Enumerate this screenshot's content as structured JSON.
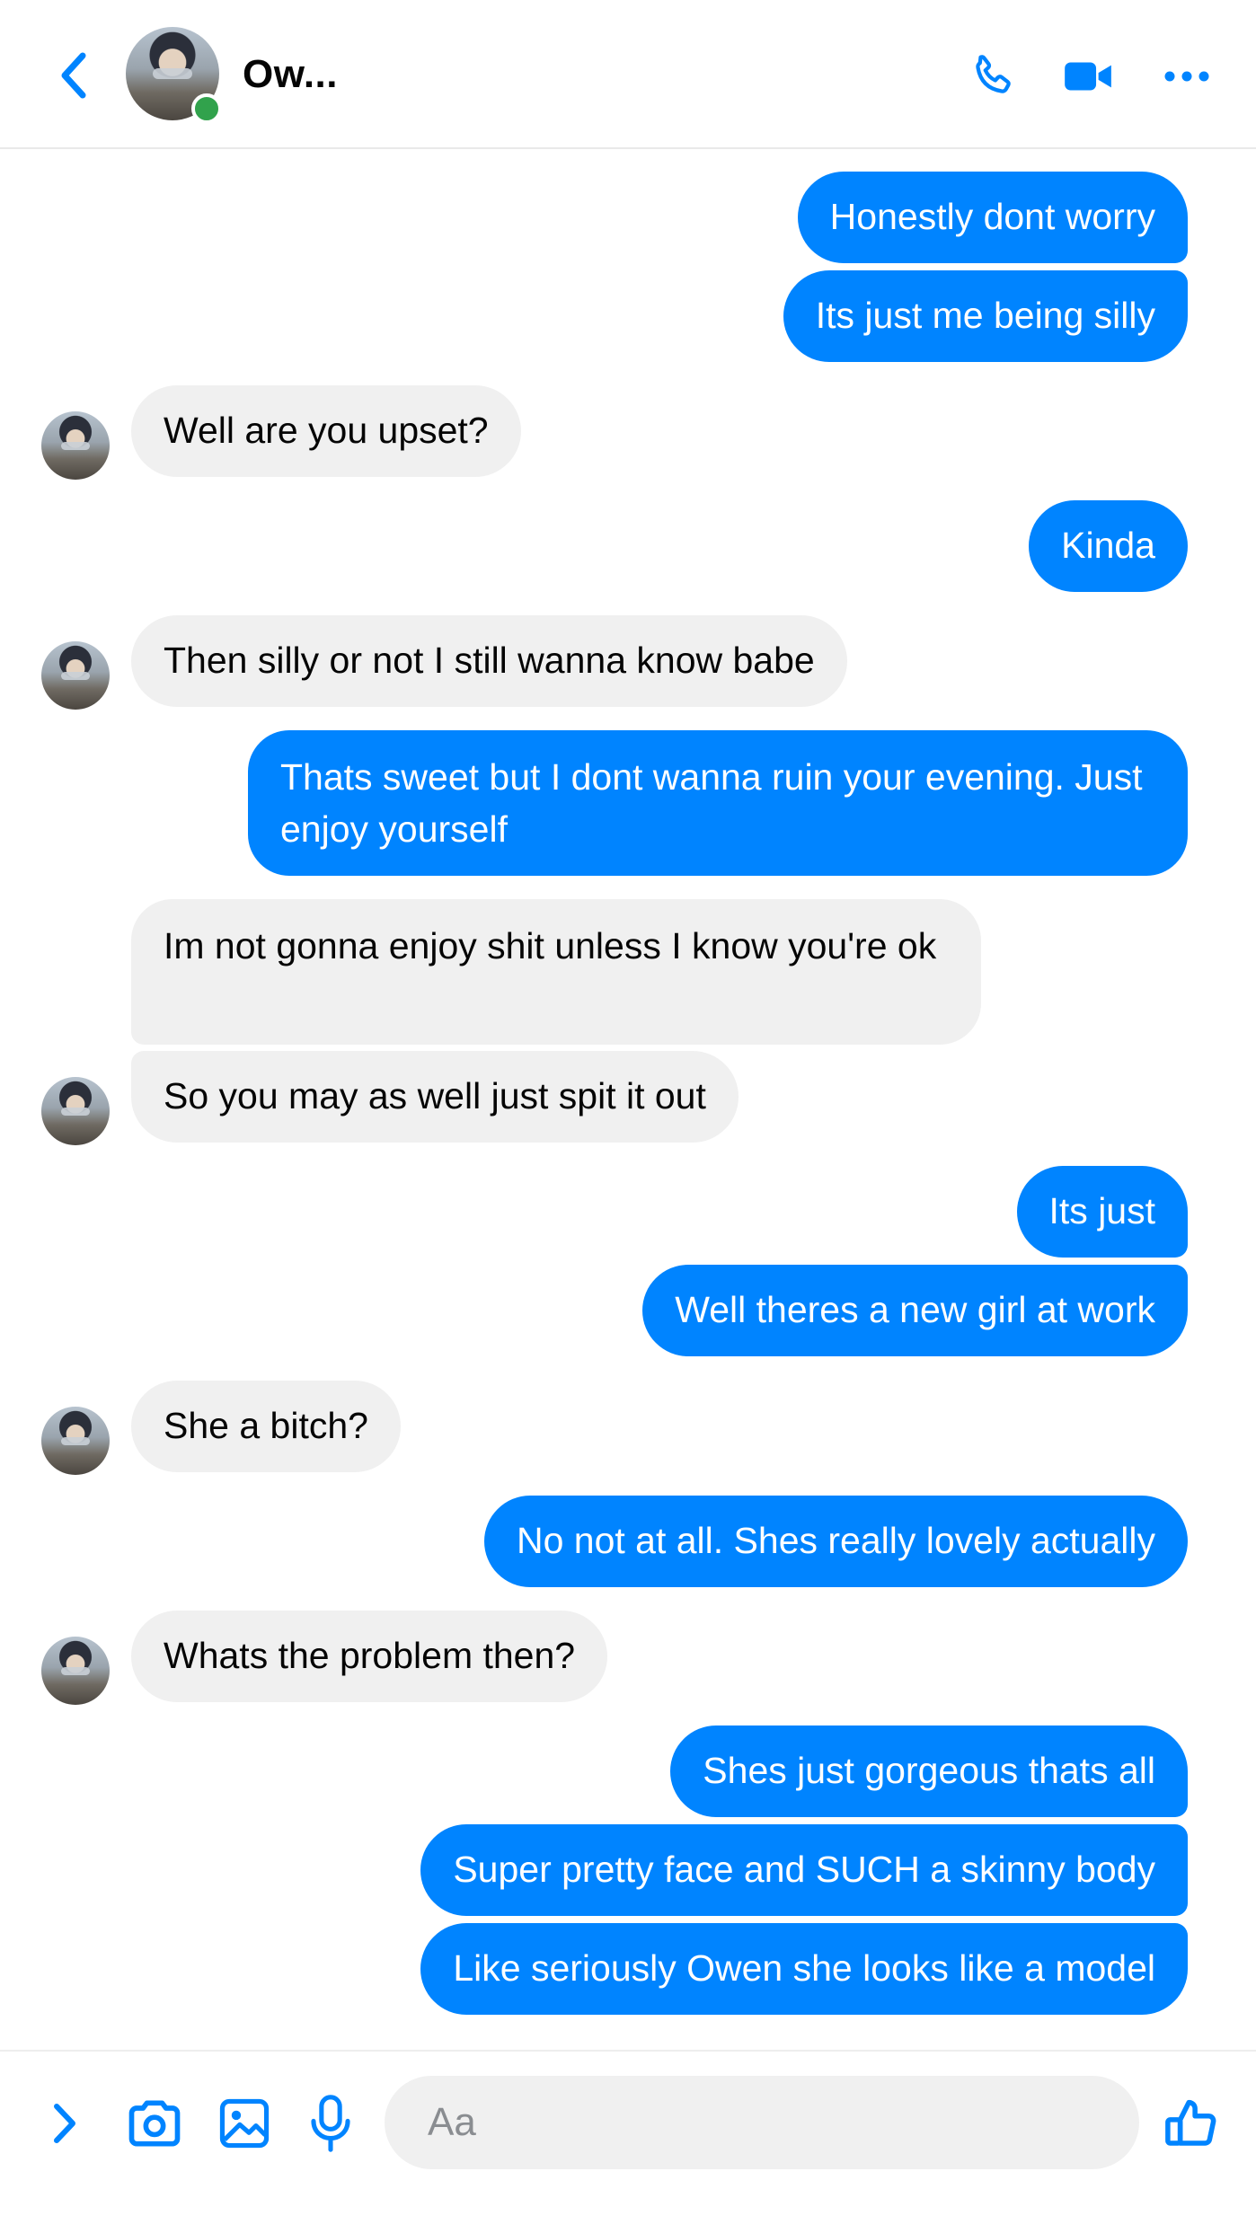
{
  "header": {
    "contact_name": "Ow...",
    "online": true,
    "icons": [
      "back-icon",
      "phone-icon",
      "video-camera-icon",
      "more-icon"
    ]
  },
  "messages": [
    {
      "from": "me",
      "text": "Honestly dont worry"
    },
    {
      "from": "me",
      "text": "Its just me being silly"
    },
    {
      "from": "them",
      "text": "Well are you upset?"
    },
    {
      "from": "me",
      "text": "Kinda"
    },
    {
      "from": "them",
      "text": "Then silly or not I still wanna know babe"
    },
    {
      "from": "me",
      "text": "Thats sweet but I dont wanna ruin your evening. Just enjoy yourself"
    },
    {
      "from": "them",
      "text": "Im not gonna enjoy shit unless I know you're ok"
    },
    {
      "from": "them",
      "text": "So you may as well just spit it out"
    },
    {
      "from": "me",
      "text": "Its just"
    },
    {
      "from": "me",
      "text": "Well theres a new girl at work"
    },
    {
      "from": "them",
      "text": "She a bitch?"
    },
    {
      "from": "me",
      "text": "No not at all. Shes really lovely actually"
    },
    {
      "from": "them",
      "text": "Whats the problem then?"
    },
    {
      "from": "me",
      "text": "Shes just gorgeous thats all"
    },
    {
      "from": "me",
      "text": "Super pretty face and SUCH a skinny body"
    },
    {
      "from": "me",
      "text": "Like seriously Owen she looks like a model"
    }
  ],
  "composer": {
    "placeholder": "Aa",
    "icons": [
      "expand-icon",
      "camera-icon",
      "gallery-icon",
      "microphone-icon",
      "thumbs-up-icon"
    ]
  },
  "colors": {
    "accent": "#0084ff",
    "incoming_bubble": "#f0f0f0",
    "online": "#31a24c"
  }
}
